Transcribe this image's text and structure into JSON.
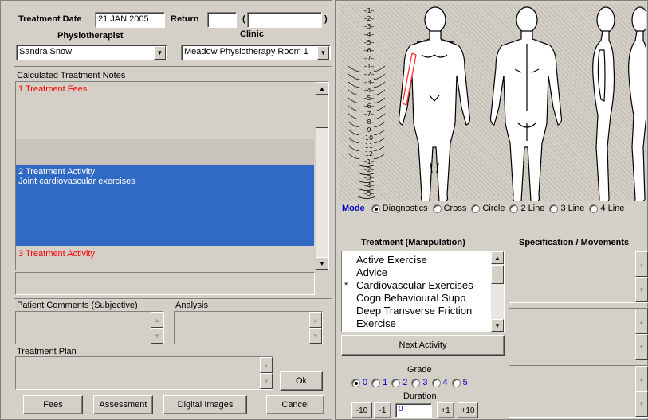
{
  "header": {
    "treatment_date_label": "Treatment Date",
    "treatment_date_value": "21 JAN 2005",
    "return_label": "Return",
    "return_value": "",
    "paren_open": "(",
    "paren_close": ")",
    "physiotherapist_label": "Physiotherapist",
    "clinic_label": "Clinic",
    "physiotherapist_value": "Sandra Snow",
    "clinic_value": "Meadow Physiotherapy Room 1"
  },
  "notes": {
    "label": "Calculated Treatment Notes",
    "entries": [
      {
        "title": "1  Treatment Fees",
        "detail": ""
      },
      {
        "title": "2 Treatment Activity",
        "detail": "Joint  cardiovascular exercises"
      },
      {
        "title": "3 Treatment Activity",
        "detail": ""
      }
    ]
  },
  "bottom_left": {
    "patient_comments_label": "Patient Comments (Subjective)",
    "analysis_label": "Analysis",
    "treatment_plan_label": "Treatment Plan",
    "ok_label": "Ok",
    "fees_label": "Fees",
    "assessment_label": "Assessment",
    "digital_images_label": "Digital Images",
    "cancel_label": "Cancel"
  },
  "body_chart": {
    "vertebra_labels": [
      "1",
      "2",
      "3",
      "4",
      "5",
      "6",
      "7",
      "1",
      "2",
      "3",
      "4",
      "5",
      "6",
      "7",
      "8",
      "9",
      "10",
      "11",
      "12",
      "1",
      "2",
      "3",
      "4",
      "5"
    ],
    "mode_label": "Mode",
    "modes": [
      "Diagnostics",
      "Cross",
      "Circle",
      "2 Line",
      "3 Line",
      "4 Line"
    ],
    "selected_mode": "Diagnostics"
  },
  "treatment": {
    "manipulation_header": "Treatment (Manipulation)",
    "specification_header": "Specification / Movements",
    "items": [
      {
        "marker": "",
        "label": "Active Exercise"
      },
      {
        "marker": "",
        "label": "Advice"
      },
      {
        "marker": "*",
        "label": "Cardiovascular Exercises"
      },
      {
        "marker": "",
        "label": "Cogn Behavioural Supp"
      },
      {
        "marker": "",
        "label": "Deep Transverse Friction"
      },
      {
        "marker": "",
        "label": "Exercise"
      }
    ],
    "next_activity_label": "Next Activity",
    "grade_label": "Grade",
    "grades": [
      "0",
      "1",
      "2",
      "3",
      "4",
      "5"
    ],
    "selected_grade": "0",
    "duration_label": "Duration",
    "duration_buttons": [
      "-10",
      "-1",
      "+1",
      "+10"
    ],
    "duration_value": "0"
  },
  "colors": {
    "window_bg": "#d4d0c8",
    "selection_bg": "#316ac5",
    "note_red": "#ff0000",
    "mode_link": "#0000cc"
  }
}
